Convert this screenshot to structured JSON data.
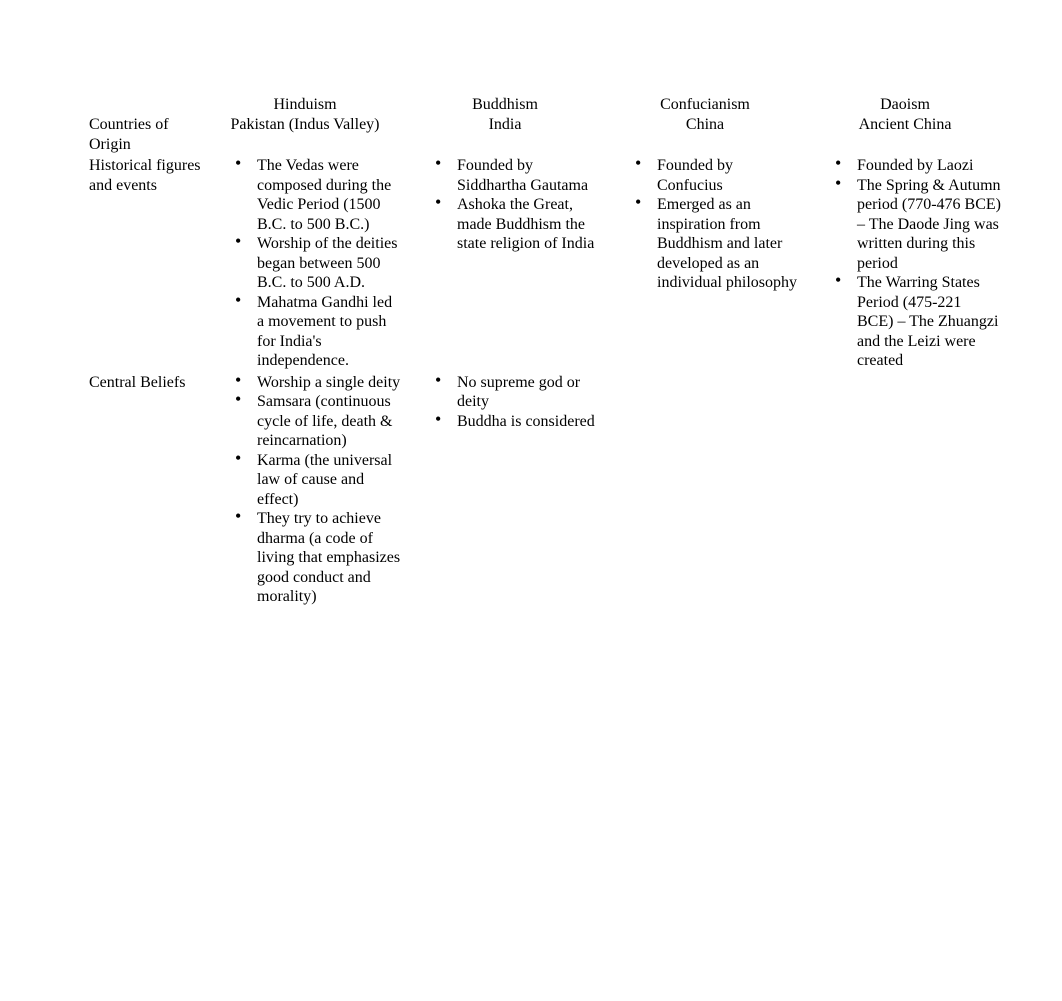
{
  "headers": {
    "col1": "Hinduism",
    "col2": "Buddhism",
    "col3": "Confucianism",
    "col4": "Daoism"
  },
  "rows": {
    "origin": {
      "label": "Countries of Origin",
      "col1": "Pakistan (Indus Valley)",
      "col2": "India",
      "col3": "China",
      "col4": "Ancient China"
    },
    "historical": {
      "label": "Historical figures and events",
      "col1": {
        "items": [
          "The Vedas were composed during the Vedic Period (1500 B.C. to 500 B.C.)",
          "Worship of the deities began between 500 B.C. to 500 A.D.",
          "Mahatma Gandhi led a movement to push for India's independence."
        ]
      },
      "col2": {
        "items": [
          "Founded by Siddhartha Gautama",
          "Ashoka the Great, made Buddhism the state religion of India"
        ]
      },
      "col3": {
        "items": [
          "Founded by Confucius",
          "Emerged as an inspiration from Buddhism and later developed as an individual philosophy"
        ]
      },
      "col4": {
        "items": [
          "Founded by Laozi",
          "The Spring & Autumn period (770-476 BCE) – The Daode Jing was written during this period",
          "The Warring States Period (475-221 BCE) – The Zhuangzi and the Leizi were created"
        ]
      }
    },
    "beliefs": {
      "label": "Central Beliefs",
      "col1": {
        "items": [
          "Worship a single deity",
          "Samsara (continuous cycle of life, death & reincarnation)",
          "Karma (the universal law of cause and effect)",
          "They try to achieve dharma (a code of living that emphasizes good conduct and morality)"
        ]
      },
      "col2": {
        "visible": [
          "No supreme god or deity",
          "Buddha is considered"
        ]
      }
    }
  }
}
